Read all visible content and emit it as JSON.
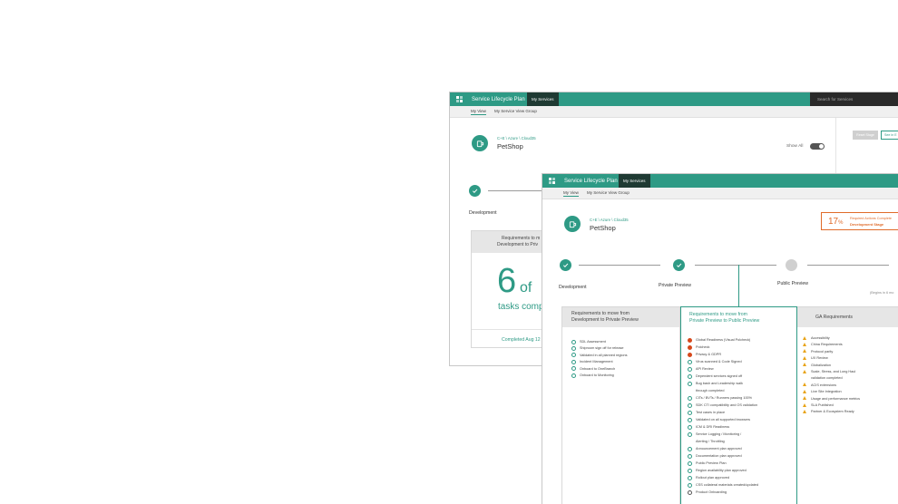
{
  "app": {
    "title": "Service Lifecycle Plan",
    "my_services_tab": "My Services",
    "search_placeholder": "Search for Services",
    "subnav": [
      "My View",
      "My Service View Group"
    ]
  },
  "service": {
    "path": "C+E \\ Azure \\ Cloud35",
    "name": "PetShop"
  },
  "back_window": {
    "show_all_label": "Show All",
    "button_reset": "Reset Stage",
    "button_see": "See in E",
    "stage_label": "Development",
    "card_header_line1": "Requirements to m",
    "card_header_line2": "Development to Priv",
    "task_count": "6",
    "task_of": "of",
    "task_caption": "tasks comp",
    "completed": "Completed Aug 12"
  },
  "front_window": {
    "progress_percent": "17",
    "progress_unit": "%",
    "progress_title": "Required Actions Complete",
    "progress_stage": "Development Stage",
    "stages": [
      {
        "label": "Development",
        "state": "done"
      },
      {
        "label": "Private Preview",
        "state": "done"
      },
      {
        "label": "Public Preview",
        "state": "pending"
      }
    ],
    "public_preview_note": "(Begins in 6 mo",
    "columns": [
      {
        "header_line1": "Requirements to move from",
        "header_line2": "Development to Private Preview",
        "items": [
          {
            "status": "ok",
            "text": "SDL Assessment"
          },
          {
            "status": "ok",
            "text": "Shiproom sign off for release"
          },
          {
            "status": "ok",
            "text": "Validated in all planned regions"
          },
          {
            "status": "ok",
            "text": "Incident Management"
          },
          {
            "status": "ok",
            "text": "Onboard to OneBranch"
          },
          {
            "status": "ok",
            "text": "Onboard to Monitoring"
          }
        ]
      },
      {
        "header_line1": "Requirements to move from",
        "header_line2": "Private Preview to  Public Preview",
        "items": [
          {
            "status": "err",
            "text": "Global Readiness (Visual Polcheck)"
          },
          {
            "status": "err",
            "text": "Polcheck"
          },
          {
            "status": "err",
            "text": "Privacy & GDPR"
          },
          {
            "status": "ok",
            "text": "Virus scanned & Code Signed"
          },
          {
            "status": "ok",
            "text": "API Review"
          },
          {
            "status": "ok",
            "text": "Dependent services signed off"
          },
          {
            "status": "ok",
            "text": "Bug bash and Leadership walk"
          },
          {
            "status": "none",
            "text": "through completed"
          },
          {
            "status": "ok",
            "text": "CITs / BVTs / Runners passing 100%"
          },
          {
            "status": "ok",
            "text": "SDK CTI compatibility and OS validation"
          },
          {
            "status": "ok",
            "text": "Test cases in place"
          },
          {
            "status": "ok",
            "text": "Validated on all supported browsers"
          },
          {
            "status": "ok",
            "text": "ICM & DRI Readiness"
          },
          {
            "status": "ok",
            "text": "Service Logging / Monitoring /"
          },
          {
            "status": "none",
            "text": "Alerting / Throttling"
          },
          {
            "status": "ok",
            "text": "Announcement plan approved"
          },
          {
            "status": "ok",
            "text": "Documentation plan approved"
          },
          {
            "status": "ok",
            "text": "Public Preview Plan"
          },
          {
            "status": "ok",
            "text": "Region availability plan approved"
          },
          {
            "status": "ok",
            "text": "Rollout plan approved"
          },
          {
            "status": "ok",
            "text": "CSS collateral materials created/updated"
          },
          {
            "status": "block",
            "text": "Product Onboarding"
          }
        ]
      },
      {
        "header_line1": "GA Requirements",
        "header_line2": "",
        "items": [
          {
            "status": "warn",
            "text": "Accessibility"
          },
          {
            "status": "warn",
            "text": "China Requirements"
          },
          {
            "status": "warn",
            "text": "Protocol parity"
          },
          {
            "status": "warn",
            "text": "UX Review"
          },
          {
            "status": "warn",
            "text": "Globalization"
          },
          {
            "status": "warn",
            "text": "Scale, Stress, and Long Haul"
          },
          {
            "status": "none",
            "text": "validation completed"
          },
          {
            "status": "warn",
            "text": "ACIS extensions"
          },
          {
            "status": "warn",
            "text": "Live Site Integration"
          },
          {
            "status": "warn",
            "text": "Usage and performance metrics"
          },
          {
            "status": "warn",
            "text": "SLA Published"
          },
          {
            "status": "warn",
            "text": "Partner & Ecosystem Ready"
          }
        ]
      }
    ]
  },
  "colors": {
    "accent": "#2e9a85",
    "error": "#d6481b",
    "warning": "#e8a317",
    "progress": "#e06b2a"
  }
}
